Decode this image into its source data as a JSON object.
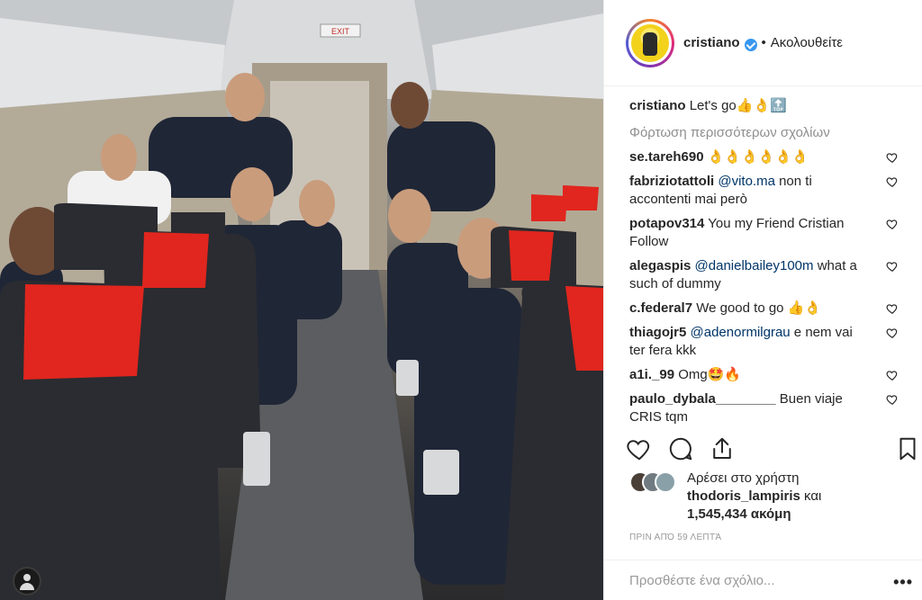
{
  "post": {
    "image_description_alt": "",
    "exit_sign": "EXIT"
  },
  "header": {
    "username": "cristiano",
    "separator": "•",
    "follow_label": "Ακολουθείτε"
  },
  "caption": {
    "username": "cristiano",
    "text": "Let's go👍👌🔝"
  },
  "load_more": "Φόρτωση περισσότερων σχολίων",
  "comments": [
    {
      "username": "se.tareh690",
      "mention": "",
      "text": "👌👌👌👌👌👌"
    },
    {
      "username": "fabriziotattoli",
      "mention": "@vito.ma",
      "text": " non ti accontenti mai però"
    },
    {
      "username": "potapov314",
      "mention": "",
      "text": "You my Friend Cristian Follow"
    },
    {
      "username": "alegaspis",
      "mention": "@danielbailey100m",
      "text": " what a such of dummy"
    },
    {
      "username": "c.federal7",
      "mention": "",
      "text": "We good to go 👍👌"
    },
    {
      "username": "thiagojr5",
      "mention": "@adenormilgrau",
      "text": " e nem vai ter fera kkk"
    },
    {
      "username": "a1i._99",
      "mention": "",
      "text": "Omg🤩🔥"
    },
    {
      "username": "paulo_dybala________",
      "mention": "",
      "text": "Buen viaje CRIS tqm"
    }
  ],
  "likes": {
    "prefix": "Αρέσει στο χρήστη",
    "user": "thodoris_lampiris",
    "conjunction": " και",
    "count": "1,545,434 ακόμη"
  },
  "timestamp": "ΠΡΙΝ ΑΠΌ 59 ΛΕΠΤΆ",
  "add_comment": {
    "placeholder": "Προσθέστε ένα σχόλιο..."
  },
  "more_label": "•••",
  "colors": {
    "verified": "#3897f0",
    "seat_headrest": "#e8261f",
    "mention": "#003569"
  }
}
